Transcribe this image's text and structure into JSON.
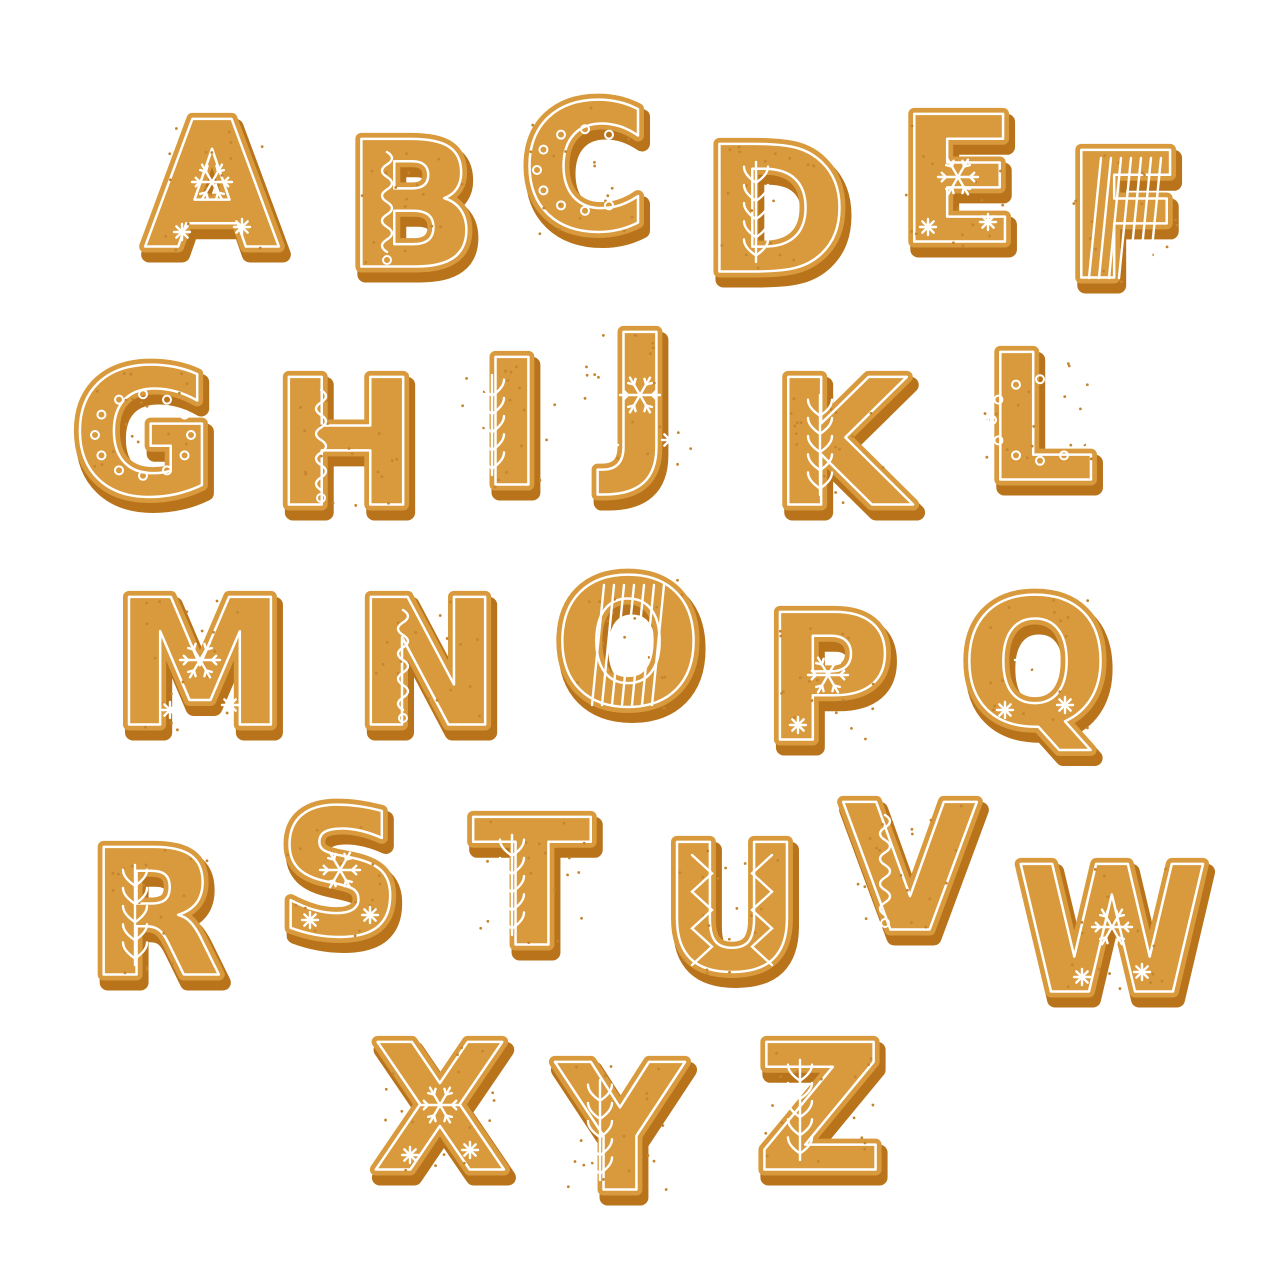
{
  "colors": {
    "background": "#ffffff",
    "cookie_body": "#d89a3c",
    "cookie_shadow": "#b8731b",
    "icing": "#ffffff",
    "speckle": "#c48530"
  },
  "letters": [
    {
      "char": "A",
      "decoration": "snowflake"
    },
    {
      "char": "B",
      "decoration": "wave"
    },
    {
      "char": "C",
      "decoration": "dots"
    },
    {
      "char": "D",
      "decoration": "branch"
    },
    {
      "char": "E",
      "decoration": "snowflake"
    },
    {
      "char": "F",
      "decoration": "stripes"
    },
    {
      "char": "G",
      "decoration": "dots"
    },
    {
      "char": "H",
      "decoration": "wave"
    },
    {
      "char": "I",
      "decoration": "branch"
    },
    {
      "char": "J",
      "decoration": "snowflake"
    },
    {
      "char": "K",
      "decoration": "branch"
    },
    {
      "char": "L",
      "decoration": "dots"
    },
    {
      "char": "M",
      "decoration": "snowflake"
    },
    {
      "char": "N",
      "decoration": "wave"
    },
    {
      "char": "O",
      "decoration": "stripes"
    },
    {
      "char": "P",
      "decoration": "snowflake"
    },
    {
      "char": "Q",
      "decoration": "snowflake"
    },
    {
      "char": "R",
      "decoration": "branch"
    },
    {
      "char": "S",
      "decoration": "snowflake"
    },
    {
      "char": "T",
      "decoration": "branch"
    },
    {
      "char": "U",
      "decoration": "zigzag"
    },
    {
      "char": "V",
      "decoration": "wave"
    },
    {
      "char": "W",
      "decoration": "snowflake"
    },
    {
      "char": "X",
      "decoration": "snowflake"
    },
    {
      "char": "Y",
      "decoration": "branch"
    },
    {
      "char": "Z",
      "decoration": "branch"
    }
  ]
}
